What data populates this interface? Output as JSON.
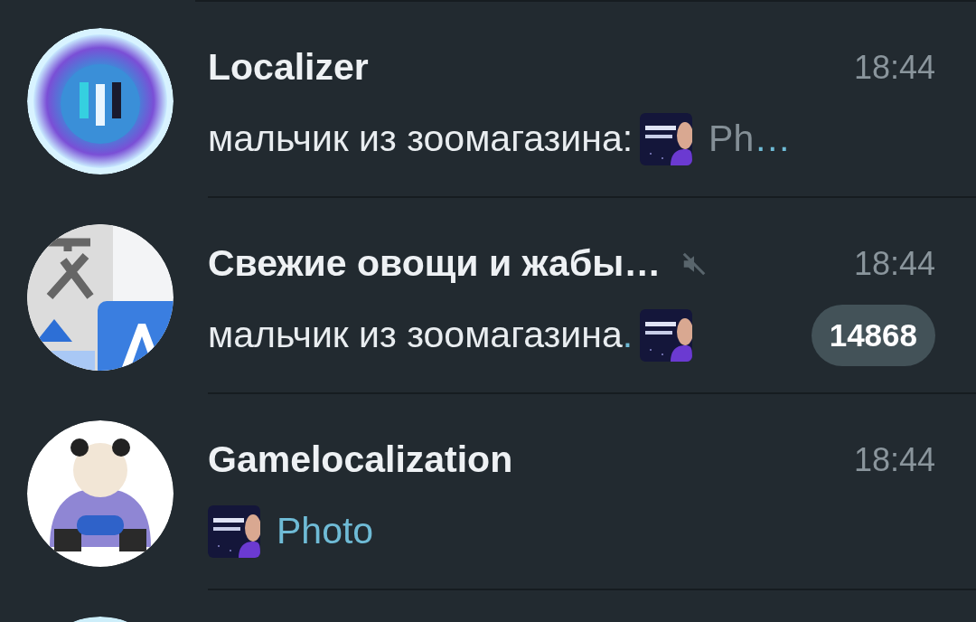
{
  "chats": [
    {
      "avatar": {
        "kind": "picture"
      },
      "title": "Localizer",
      "muted": false,
      "time": "18:44",
      "preview": {
        "sender": "мальчик из зоомагазина:",
        "media": {
          "kind": "picture"
        },
        "media_label": "Ph",
        "label_ellipsis": "…"
      }
    },
    {
      "avatar": {
        "kind": "picture"
      },
      "title": "Свежие овощи и жабы…",
      "muted": true,
      "time": "18:44",
      "preview": {
        "sender": "мальчик из зоомагазина",
        "sender_ellipsis": ".",
        "media": {
          "kind": "picture"
        }
      },
      "unread": "14868"
    },
    {
      "avatar": {
        "kind": "picture"
      },
      "title": "Gamelocalization",
      "muted": false,
      "time": "18:44",
      "preview": {
        "media": {
          "kind": "picture"
        },
        "media_label": "Photo"
      }
    },
    {
      "avatar": {
        "kind": "picture"
      }
    }
  ]
}
